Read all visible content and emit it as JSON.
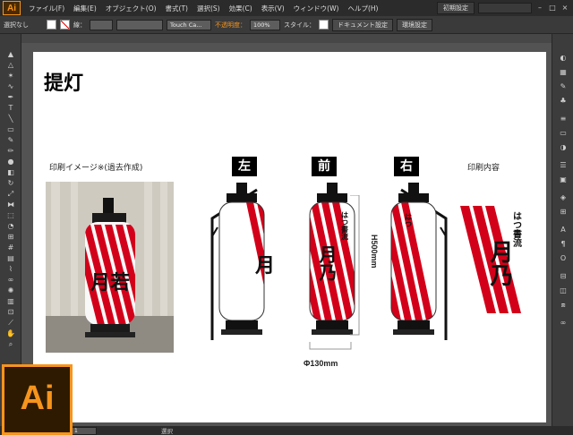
{
  "menubar": {
    "logo": "Ai",
    "items": [
      "ファイル(F)",
      "編集(E)",
      "オブジェクト(O)",
      "書式(T)",
      "選択(S)",
      "効果(C)",
      "表示(V)",
      "ウィンドウ(W)",
      "ヘルプ(H)"
    ],
    "workspace": "初期設定",
    "window_controls": [
      "–",
      "□",
      "×"
    ]
  },
  "control_bar": {
    "selection_label": "選択なし",
    "stroke_label": "線：",
    "brush_value": "Touch Ca...",
    "opacity_label": "不透明度：",
    "opacity_value": "100%",
    "style_label": "スタイル：",
    "document_settings": "ドキュメント設定",
    "preferences": "環境設定"
  },
  "artboard": {
    "title": "提灯",
    "caption_photo": "印刷イメージ※(過去作成)",
    "caption_print": "印刷内容",
    "tag_left": "左",
    "tag_front": "前",
    "tag_right": "右",
    "height_dim": "H500mm",
    "diameter_dim": "Φ130mm",
    "lantern_top_text": "はつ書流",
    "lantern_main_text": "月乃",
    "photo_main_text": "月若"
  },
  "status_bar": {
    "zoom": "1",
    "tool_name": "選択"
  },
  "badge": {
    "text": "Ai"
  },
  "colors": {
    "accent_orange": "#f7941d",
    "stripe_red": "#d3001a",
    "ui_dark": "#2b2b2b",
    "ui_panel": "#3c3c3c",
    "pasteboard": "#535353"
  }
}
